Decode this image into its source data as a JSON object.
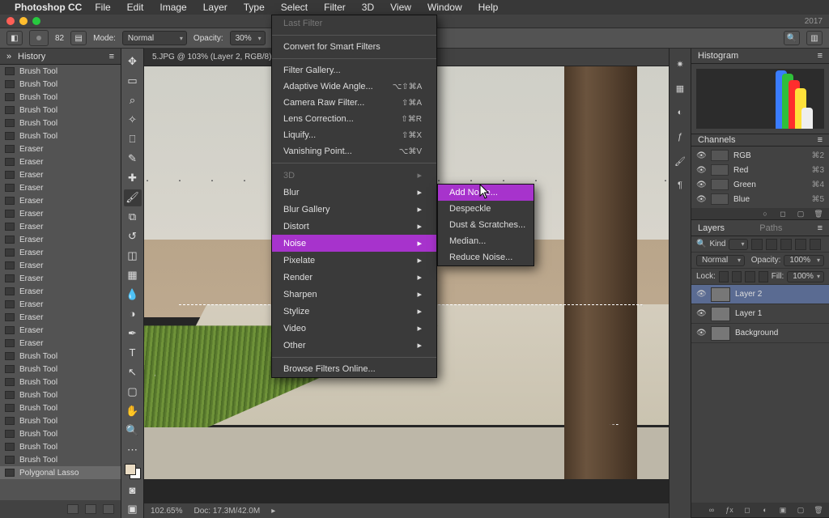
{
  "menubar": {
    "app": "Photoshop CC",
    "items": [
      "File",
      "Edit",
      "Image",
      "Layer",
      "Type",
      "Select",
      "Filter",
      "3D",
      "View",
      "Window",
      "Help"
    ],
    "active": "Filter"
  },
  "titlebar": {
    "suffix": "2017"
  },
  "options": {
    "brush_size": "82",
    "mode_label": "Mode:",
    "mode_value": "Normal",
    "opacity_label": "Opacity:",
    "opacity_value": "30%"
  },
  "history": {
    "title": "History",
    "items": [
      {
        "label": "Brush Tool"
      },
      {
        "label": "Brush Tool"
      },
      {
        "label": "Brush Tool"
      },
      {
        "label": "Brush Tool"
      },
      {
        "label": "Brush Tool"
      },
      {
        "label": "Brush Tool"
      },
      {
        "label": "Eraser"
      },
      {
        "label": "Eraser"
      },
      {
        "label": "Eraser"
      },
      {
        "label": "Eraser"
      },
      {
        "label": "Eraser"
      },
      {
        "label": "Eraser"
      },
      {
        "label": "Eraser"
      },
      {
        "label": "Eraser"
      },
      {
        "label": "Eraser"
      },
      {
        "label": "Eraser"
      },
      {
        "label": "Eraser"
      },
      {
        "label": "Eraser"
      },
      {
        "label": "Eraser"
      },
      {
        "label": "Eraser"
      },
      {
        "label": "Eraser"
      },
      {
        "label": "Eraser"
      },
      {
        "label": "Brush Tool"
      },
      {
        "label": "Brush Tool"
      },
      {
        "label": "Brush Tool"
      },
      {
        "label": "Brush Tool"
      },
      {
        "label": "Brush Tool"
      },
      {
        "label": "Brush Tool"
      },
      {
        "label": "Brush Tool"
      },
      {
        "label": "Brush Tool"
      },
      {
        "label": "Brush Tool"
      },
      {
        "label": "Polygonal Lasso",
        "active": true
      }
    ]
  },
  "document": {
    "tab": "5.JPG @ 103% (Layer 2, RGB/8) *",
    "zoom": "102.65%",
    "docinfo": "Doc: 17.3M/42.0M"
  },
  "filter_menu": {
    "last_filter": "Last Filter",
    "convert": "Convert for Smart Filters",
    "items1": [
      {
        "label": "Filter Gallery..."
      },
      {
        "label": "Adaptive Wide Angle...",
        "sc": "⌥⇧⌘A"
      },
      {
        "label": "Camera Raw Filter...",
        "sc": "⇧⌘A"
      },
      {
        "label": "Lens Correction...",
        "sc": "⇧⌘R"
      },
      {
        "label": "Liquify...",
        "sc": "⇧⌘X"
      },
      {
        "label": "Vanishing Point...",
        "sc": "⌥⌘V"
      }
    ],
    "groups": [
      "3D",
      "Blur",
      "Blur Gallery",
      "Distort",
      "Noise",
      "Pixelate",
      "Render",
      "Sharpen",
      "Stylize",
      "Video",
      "Other"
    ],
    "browse": "Browse Filters Online...",
    "highlighted": "Noise"
  },
  "noise_submenu": {
    "items": [
      "Add Noise...",
      "Despeckle",
      "Dust & Scratches...",
      "Median...",
      "Reduce Noise..."
    ],
    "highlighted": "Add Noise..."
  },
  "right": {
    "histogram_title": "Histogram",
    "channels_title": "Channels",
    "channels": [
      {
        "name": "RGB",
        "sc": "⌘2"
      },
      {
        "name": "Red",
        "sc": "⌘3"
      },
      {
        "name": "Green",
        "sc": "⌘4"
      },
      {
        "name": "Blue",
        "sc": "⌘5"
      }
    ],
    "layers_title": "Layers",
    "paths_title": "Paths",
    "kind_label": "Kind",
    "blend_mode": "Normal",
    "ly_opacity_label": "Opacity:",
    "ly_opacity_val": "100%",
    "lock_label": "Lock:",
    "fill_label": "Fill:",
    "fill_val": "100%",
    "layers": [
      {
        "name": "Layer 2",
        "sel": true
      },
      {
        "name": "Layer 1"
      },
      {
        "name": "Background"
      }
    ]
  },
  "colors": {
    "highlight": "#a733cc"
  }
}
